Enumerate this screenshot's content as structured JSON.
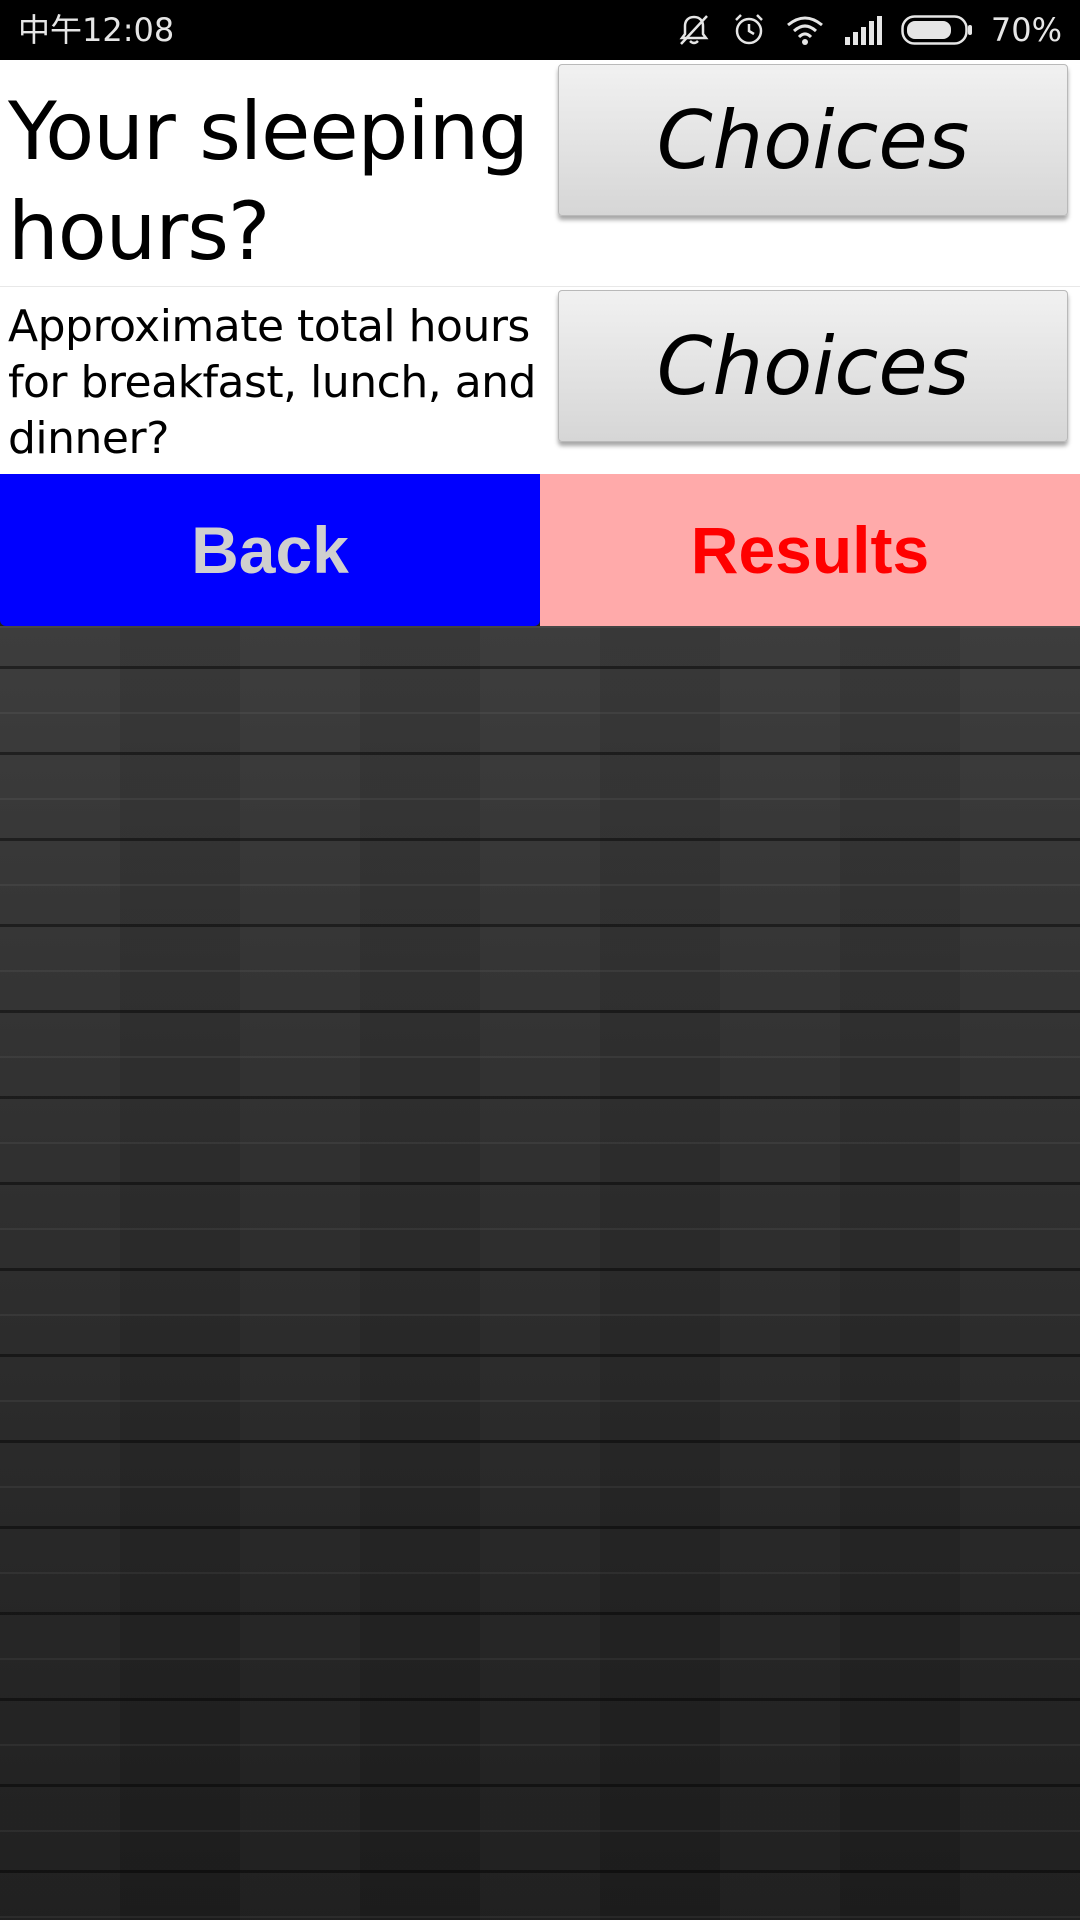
{
  "status_bar": {
    "time": "中午12:08",
    "battery_percent": "70%",
    "icons": [
      "mute-icon",
      "alarm-icon",
      "wifi-icon",
      "signal-icon",
      "battery-icon"
    ]
  },
  "questions": [
    {
      "label": "Your sleeping hours?",
      "button_label": "Choices"
    },
    {
      "label": "Approximate total hours for breakfast, lunch, and dinner?",
      "button_label": "Choices"
    }
  ],
  "actions": {
    "back_label": "Back",
    "results_label": "Results"
  },
  "colors": {
    "back_bg": "#0000ff",
    "back_text": "#cfcfcf",
    "results_bg": "#ffaaaa",
    "results_text": "#ff0000"
  }
}
